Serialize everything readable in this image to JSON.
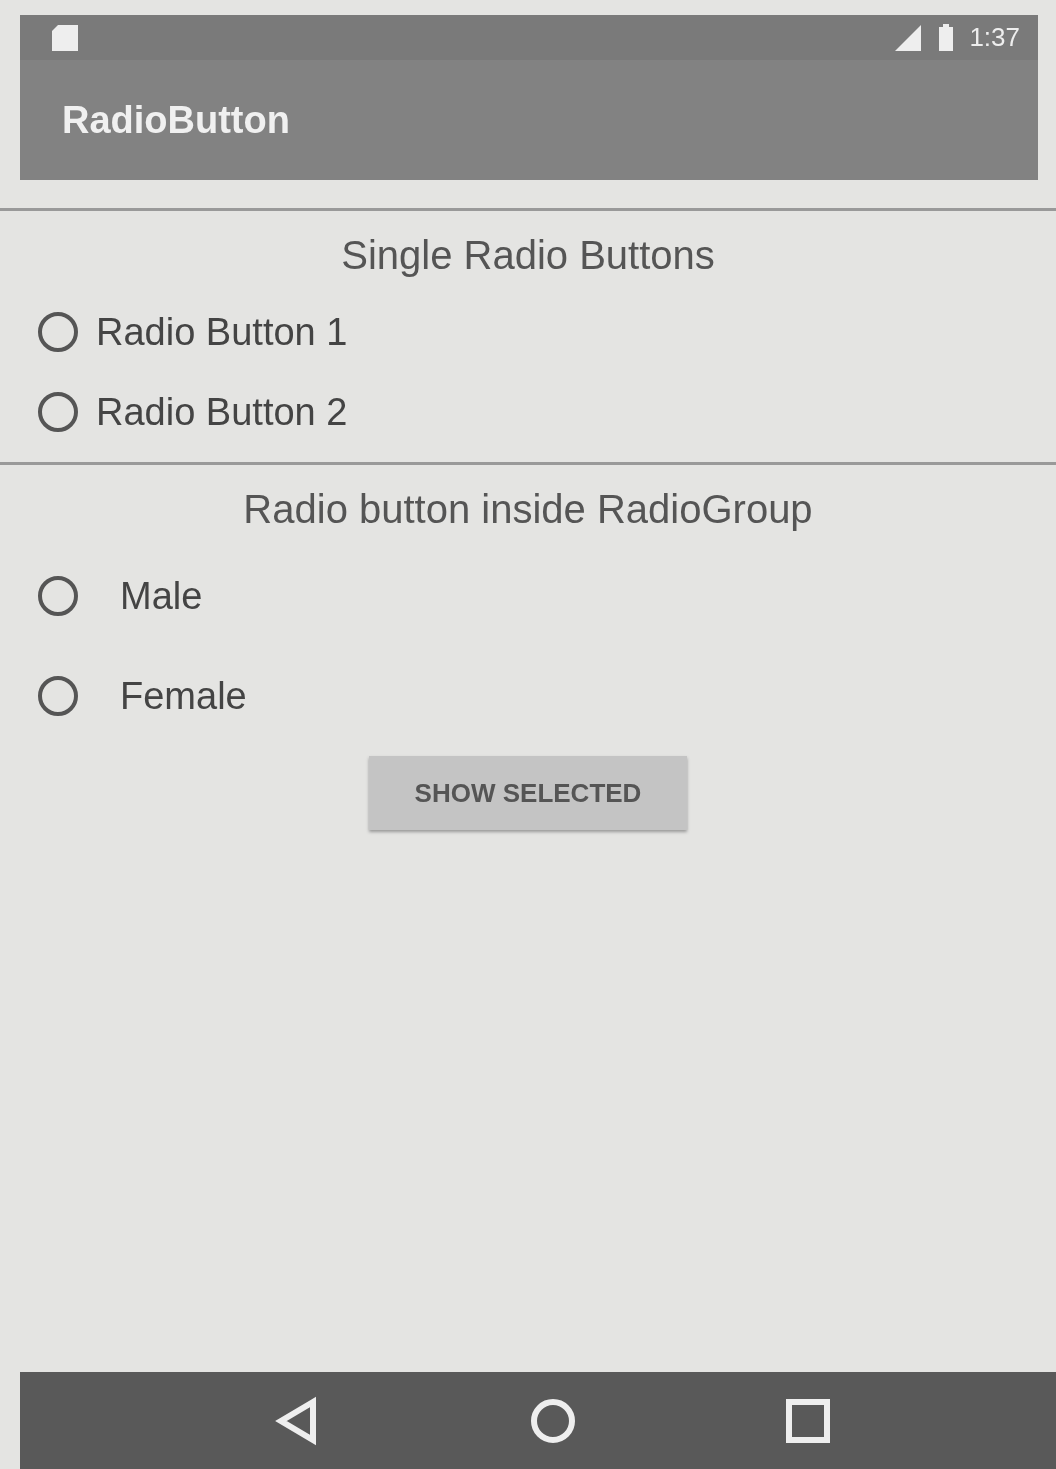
{
  "status_bar": {
    "time": "1:37"
  },
  "app_bar": {
    "title": "RadioButton"
  },
  "sections": [
    {
      "heading": "Single Radio Buttons",
      "options": [
        {
          "label": "Radio Button 1",
          "selected": false
        },
        {
          "label": "Radio Button 2",
          "selected": false
        }
      ]
    },
    {
      "heading": "Radio button inside RadioGroup",
      "options": [
        {
          "label": "Male",
          "selected": false
        },
        {
          "label": "Female",
          "selected": false
        }
      ]
    }
  ],
  "button": {
    "label": "SHOW SELECTED"
  }
}
